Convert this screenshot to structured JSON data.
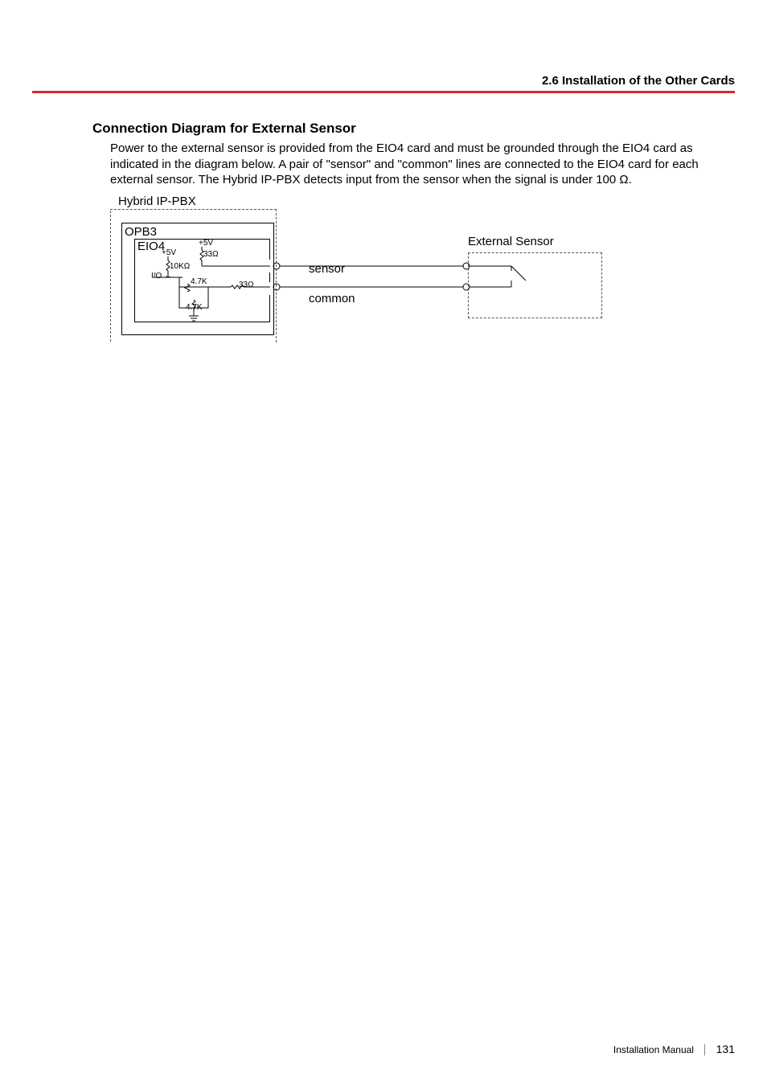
{
  "header": {
    "running_head": "2.6 Installation of the Other Cards"
  },
  "section": {
    "title": "Connection Diagram for External Sensor",
    "body": "Power to the external sensor is provided from the EIO4 card and must be grounded through the EIO4 card as indicated in the diagram below. A pair of \"sensor\" and \"common\" lines are connected to the EIO4 card for each external sensor. The Hybrid IP-PBX detects input from the sensor when the signal is under 100 Ω."
  },
  "diagram": {
    "hybrid_label": "Hybrid IP-PBX",
    "opb_label": "OPB3",
    "eio_label": "EIO4",
    "io_label": "I/O ←",
    "v5_left": "+5V",
    "v5_right": "+5V",
    "r10k": "10KΩ",
    "r33_top": "33Ω",
    "r33_series": "33Ω",
    "r47a": "4.7K",
    "r47b": "4.7K",
    "line_sensor": "sensor",
    "line_common": "common",
    "ext_sensor_label": "External Sensor"
  },
  "footer": {
    "manual": "Installation Manual",
    "page": "131"
  }
}
